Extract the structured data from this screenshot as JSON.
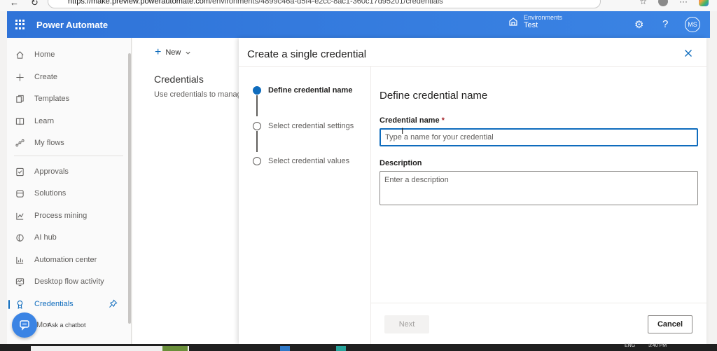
{
  "browser": {
    "url_host": "https://make.preview.powerautomate.com",
    "url_path": "/environments/4899c46a-d5f4-e2cc-8ac1-360c17d95201/credentials",
    "back_glyph": "←",
    "reload_glyph": "↻",
    "star_glyph": "☆",
    "more_glyph": "···"
  },
  "header": {
    "app_title": "Power Automate",
    "env_label": "Environments",
    "env_value": "Test",
    "settings_glyph": "⚙",
    "help_glyph": "?",
    "avatar_initials": "MS"
  },
  "leftnav": {
    "items": [
      {
        "label": "Home"
      },
      {
        "label": "Create"
      },
      {
        "label": "Templates"
      },
      {
        "label": "Learn"
      },
      {
        "label": "My flows"
      },
      {
        "label": "Approvals"
      },
      {
        "label": "Solutions"
      },
      {
        "label": "Process mining"
      },
      {
        "label": "AI hub"
      },
      {
        "label": "Automation center"
      },
      {
        "label": "Desktop flow activity"
      },
      {
        "label": "Credentials"
      }
    ],
    "more_label": "Mor",
    "chatbot_label": "Ask a chatbot"
  },
  "main": {
    "new_label": "New",
    "page_title": "Credentials",
    "page_subtitle": "Use credentials to manag"
  },
  "panel": {
    "title": "Create a single credential",
    "steps": [
      {
        "label": "Define credential name"
      },
      {
        "label": "Select credential settings"
      },
      {
        "label": "Select credential values"
      }
    ],
    "form_title": "Define credential name",
    "name_label": "Credential name",
    "required_mark": "*",
    "name_placeholder": "Type a name for your credential",
    "desc_label": "Description",
    "desc_placeholder": "Enter a description",
    "next_label": "Next",
    "cancel_label": "Cancel"
  },
  "taskbar": {
    "lang": "ENG",
    "time": "3:40 PM"
  },
  "colors": {
    "brand": "#0f6cbd",
    "header": "#3b84e4"
  }
}
